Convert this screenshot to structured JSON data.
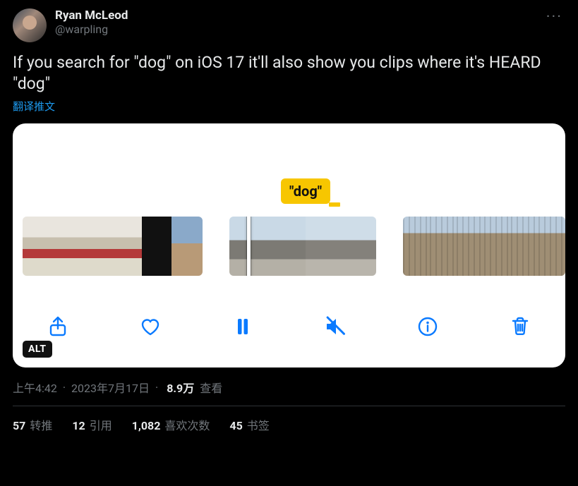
{
  "author": {
    "display_name": "Ryan McLeod",
    "handle": "@warpling"
  },
  "tweet_text": "If you search for \"dog\" on iOS 17 it'll also show you clips where it's HEARD \"dog\"",
  "translate_label": "翻译推文",
  "media": {
    "search_label": "\"dog\"",
    "alt_badge": "ALT",
    "toolbar_icons": {
      "share": "share-icon",
      "heart": "heart-icon",
      "pause": "pause-icon",
      "mute": "speaker-slash-icon",
      "info": "info-icon",
      "trash": "trash-icon"
    }
  },
  "meta": {
    "time": "上午4:42",
    "date": "2023年7月17日",
    "views_number": "8.9万",
    "views_label": "查看"
  },
  "stats": {
    "retweets": {
      "count": "57",
      "label": "转推"
    },
    "quotes": {
      "count": "12",
      "label": "引用"
    },
    "likes": {
      "count": "1,082",
      "label": "喜欢次数"
    },
    "bookmarks": {
      "count": "45",
      "label": "书签"
    }
  },
  "more_icon_glyph": "···"
}
